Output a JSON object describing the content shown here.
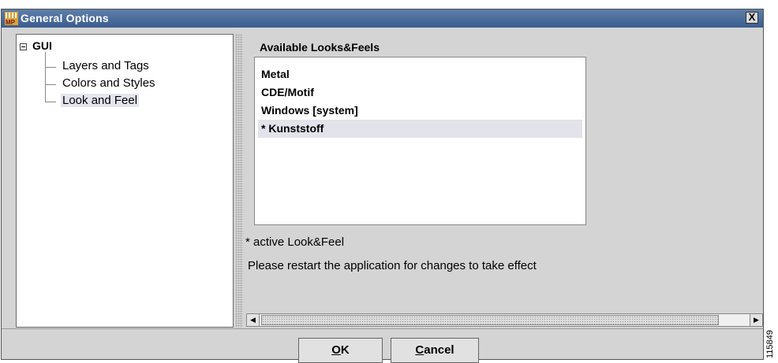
{
  "window": {
    "title": "General Options",
    "icon_label": "MP",
    "close_label": "X"
  },
  "tree": {
    "root": "GUI",
    "items": [
      {
        "label": "Layers and Tags"
      },
      {
        "label": "Colors and Styles"
      },
      {
        "label": "Look and Feel",
        "selected": true
      }
    ]
  },
  "looks": {
    "group_title": "Available Looks&Feels",
    "items": [
      "Metal",
      "CDE/Motif",
      "Windows [system]",
      "* Kunststoff"
    ],
    "selected_index": 3
  },
  "notes": {
    "active": "* active Look&Feel",
    "restart": "Please restart the application for changes to take effect"
  },
  "buttons": {
    "ok": {
      "mnemonic": "O",
      "rest": "K"
    },
    "cancel": {
      "mnemonic": "C",
      "rest": "ancel"
    }
  },
  "side_code": "115849"
}
